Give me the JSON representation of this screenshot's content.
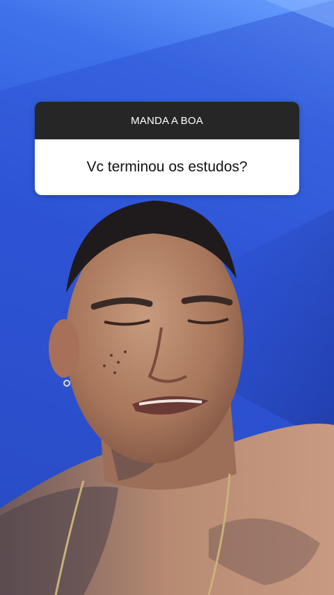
{
  "question_sticker": {
    "header": "MANDA A BOA",
    "question": "Vc terminou os estudos?"
  },
  "colors": {
    "background_blue": "#2f57d9",
    "sticker_header": "#262626",
    "sticker_body": "#ffffff"
  }
}
